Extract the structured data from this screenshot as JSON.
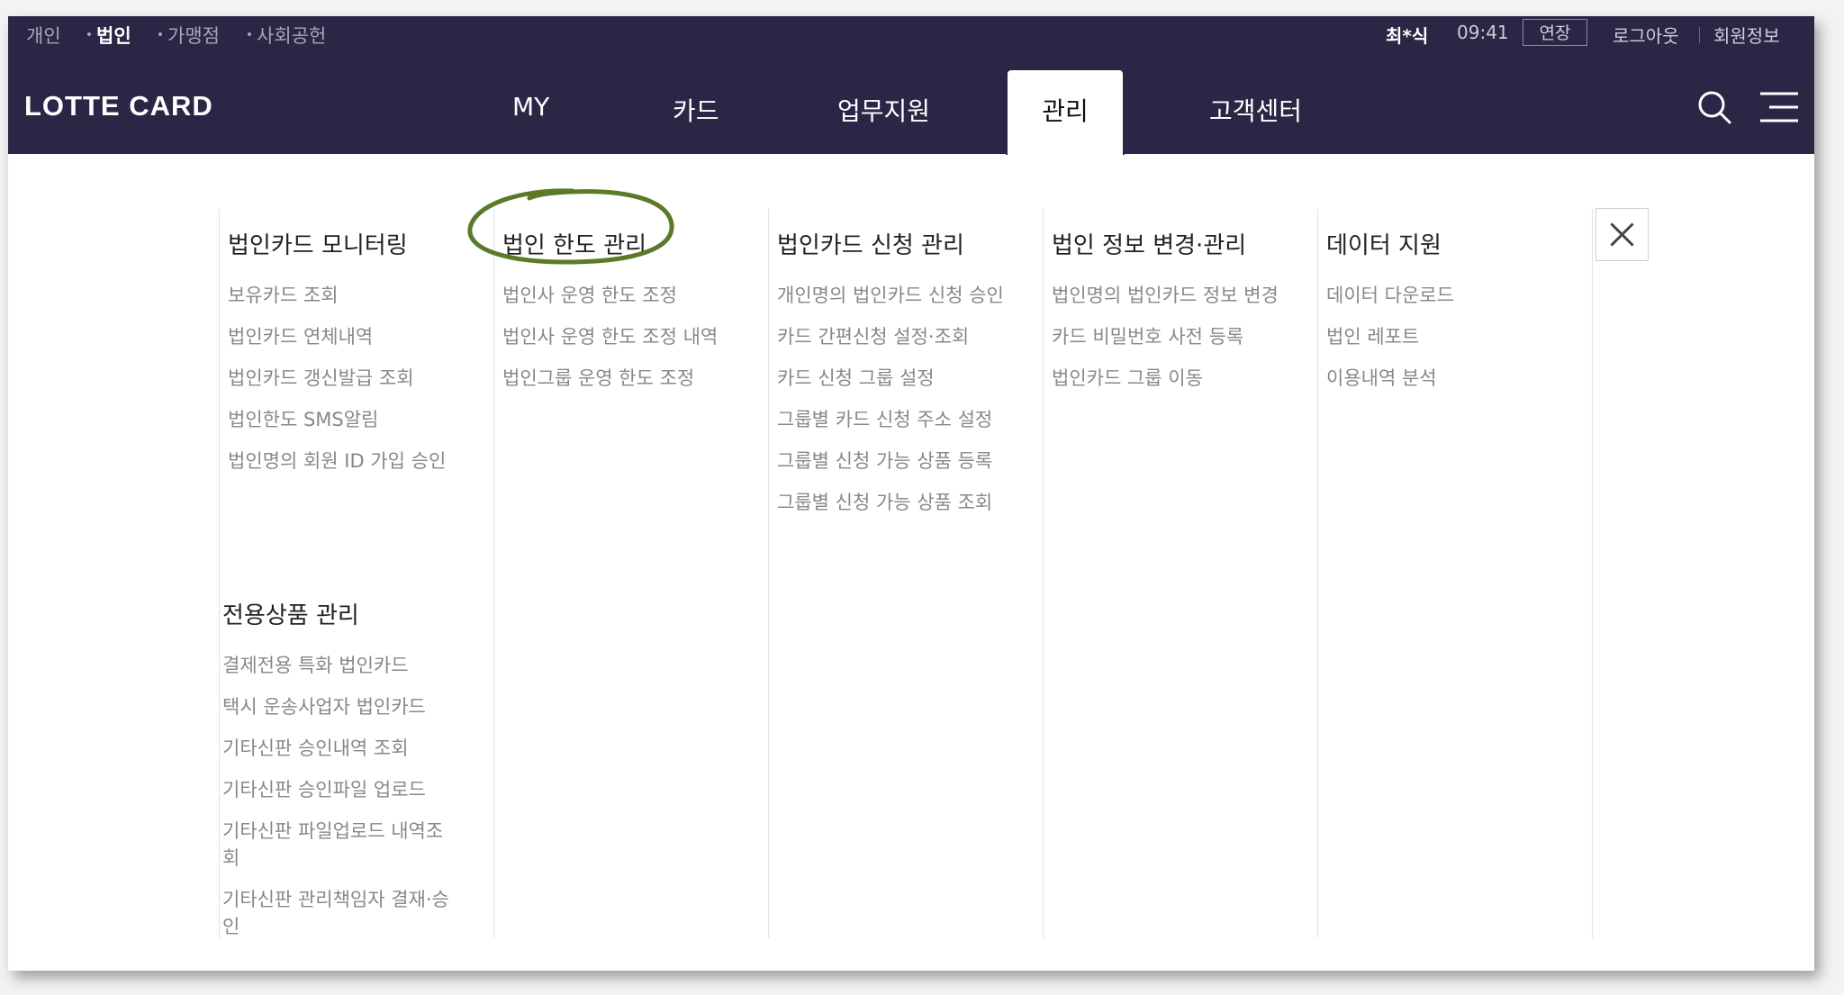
{
  "utility": {
    "segments": [
      "개인",
      "법인",
      "가맹점",
      "사회공헌"
    ],
    "user_name": "최*식",
    "timer": "09:41",
    "extend_label": "연장",
    "logout_label": "로그아웃",
    "member_info_label": "회원정보"
  },
  "brand": {
    "logo": "LOTTE CARD"
  },
  "nav": {
    "items": [
      "MY",
      "카드",
      "업무지원",
      "관리",
      "고객센터"
    ],
    "active": "관리"
  },
  "menu": {
    "columns": [
      {
        "title": "법인카드 모니터링",
        "items": [
          "보유카드 조회",
          "법인카드 연체내역",
          "법인카드 갱신발급 조회",
          "법인한도 SMS알림",
          "법인명의 회원 ID 가입 승인"
        ]
      },
      {
        "title": "법인 한도 관리",
        "items": [
          "법인사 운영 한도 조정",
          "법인사 운영 한도 조정 내역",
          "법인그룹 운영 한도 조정"
        ]
      },
      {
        "title": "법인카드 신청 관리",
        "items": [
          "개인명의 법인카드 신청 승인",
          "카드 간편신청 설정·조회",
          "카드 신청 그룹 설정",
          "그룹별 카드 신청 주소 설정",
          "그룹별 신청 가능 상품 등록",
          "그룹별 신청 가능 상품 조회"
        ]
      },
      {
        "title": "법인 정보 변경·관리",
        "items": [
          "법인명의 법인카드 정보 변경",
          "카드 비밀번호 사전 등록",
          "법인카드 그룹 이동"
        ]
      },
      {
        "title": "데이터 지원",
        "items": [
          "데이터 다운로드",
          "법인 레포트",
          "이용내역 분석"
        ]
      }
    ],
    "exclusive": {
      "title": "전용상품 관리",
      "items": [
        "결제전용 특화 법인카드",
        "택시 운송사업자 법인카드",
        "기타신판 승인내역 조회",
        "기타신판 승인파일 업로드",
        "기타신판 파일업로드 내역조회",
        "기타신판 관리책임자 결재·승인"
      ]
    }
  },
  "colors": {
    "header_bg": "#2d2545",
    "highlight_circle": "#5a7a28"
  },
  "icons": {
    "search": "search-icon",
    "menu": "hamburger-menu-icon",
    "close": "close-icon"
  }
}
